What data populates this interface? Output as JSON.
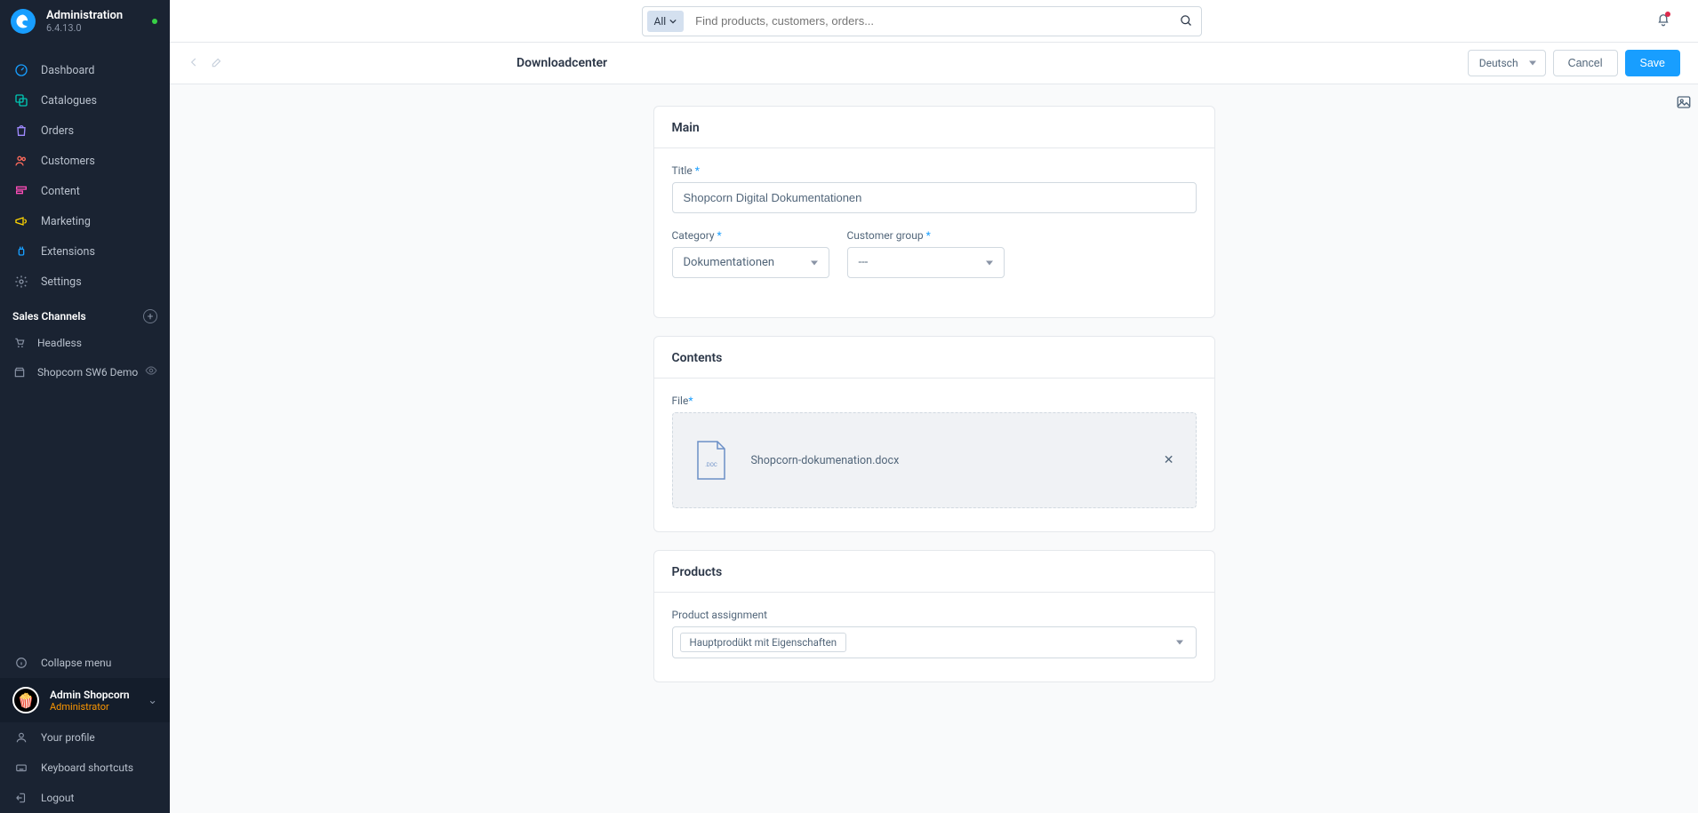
{
  "sidebar": {
    "title": "Administration",
    "version": "6.4.13.0",
    "nav": [
      {
        "label": "Dashboard",
        "icon_color": "#189eff"
      },
      {
        "label": "Catalogues",
        "icon_color": "#00c8b4"
      },
      {
        "label": "Orders",
        "icon_color": "#9e7bff"
      },
      {
        "label": "Customers",
        "icon_color": "#ff6b5c"
      },
      {
        "label": "Content",
        "icon_color": "#ff4db8"
      },
      {
        "label": "Marketing",
        "icon_color": "#ffd500"
      },
      {
        "label": "Extensions",
        "icon_color": "#189eff"
      },
      {
        "label": "Settings",
        "icon_color": "#8a94a6"
      }
    ],
    "sales_channels_title": "Sales Channels",
    "sales_channels": [
      {
        "label": "Headless"
      },
      {
        "label": "Shopcorn SW6 Demo",
        "eye": true
      }
    ],
    "collapse": "Collapse menu",
    "user": {
      "name": "Admin Shopcorn",
      "role": "Administrator"
    },
    "bottom_items": [
      "Your profile",
      "Keyboard shortcuts",
      "Logout"
    ]
  },
  "topbar": {
    "search_all": "All",
    "search_placeholder": "Find products, customers, orders..."
  },
  "actionbar": {
    "title": "Downloadcenter",
    "language": "Deutsch",
    "cancel": "Cancel",
    "save": "Save"
  },
  "cards": {
    "main": {
      "title": "Main",
      "title_label": "Title",
      "title_value": "Shopcorn Digital Dokumentationen",
      "category_label": "Category",
      "category_value": "Dokumentationen",
      "cgroup_label": "Customer group",
      "cgroup_value": "---"
    },
    "contents": {
      "title": "Contents",
      "file_label": "File",
      "file_ext": ".DOC",
      "file_name": "Shopcorn-dokumenation.docx"
    },
    "products": {
      "title": "Products",
      "assign_label": "Product assignment",
      "tag": "Hauptprodükt mit Eigenschaften"
    }
  }
}
